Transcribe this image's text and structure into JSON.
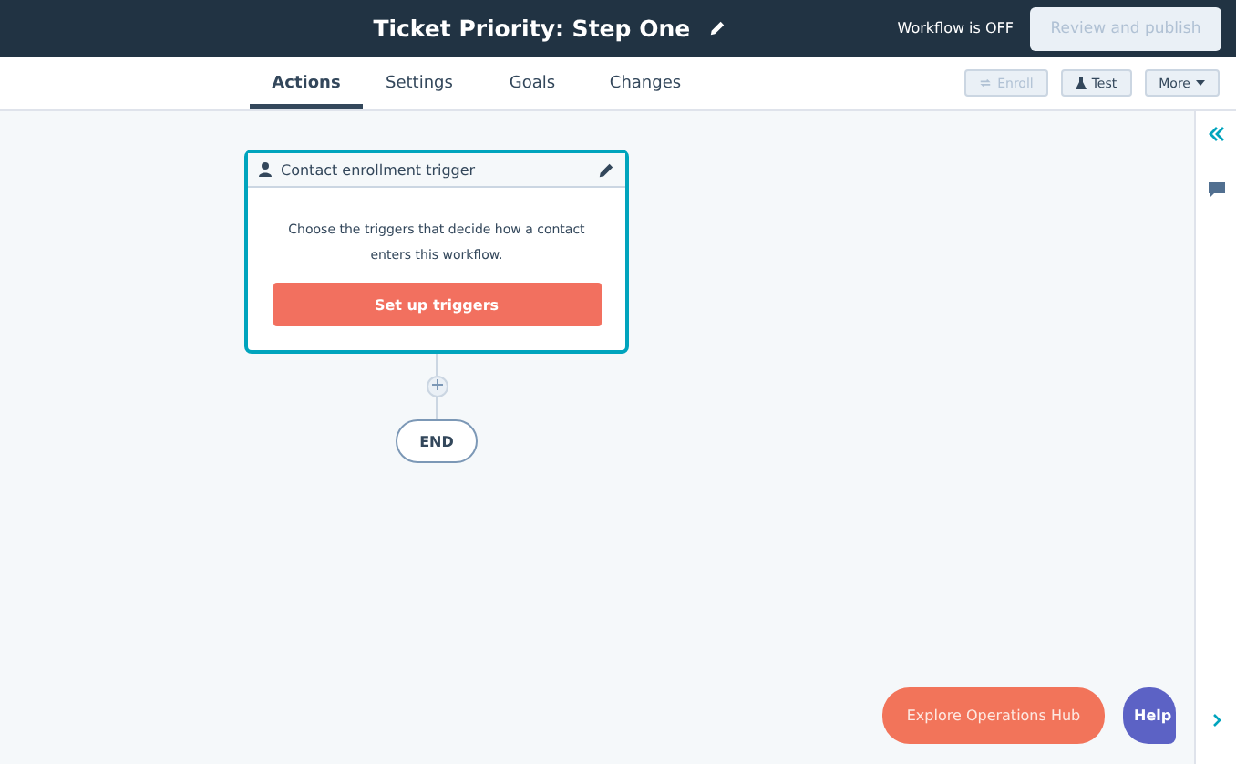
{
  "header": {
    "title": "Ticket Priority: Step One",
    "status": "Workflow is OFF",
    "publish_button": {
      "label": "Review and publish",
      "disabled": true
    }
  },
  "tabs": [
    {
      "label": "Actions",
      "selected": true
    },
    {
      "label": "Settings",
      "selected": false
    },
    {
      "label": "Goals",
      "selected": false
    },
    {
      "label": "Changes",
      "selected": false
    }
  ],
  "toolbar": [
    {
      "label": "Enroll",
      "kind": "enroll",
      "disabled": true
    },
    {
      "label": "Test",
      "kind": "test",
      "disabled": false
    },
    {
      "label": "More",
      "kind": "more",
      "disabled": false
    }
  ],
  "trigger_card": {
    "title": "Contact enrollment trigger",
    "description": "Choose the triggers that decide how a contact enters this workflow.",
    "button": "Set up triggers"
  },
  "end_node": "END",
  "explore_button": "Explore Operations Hub",
  "help_button": "Help"
}
